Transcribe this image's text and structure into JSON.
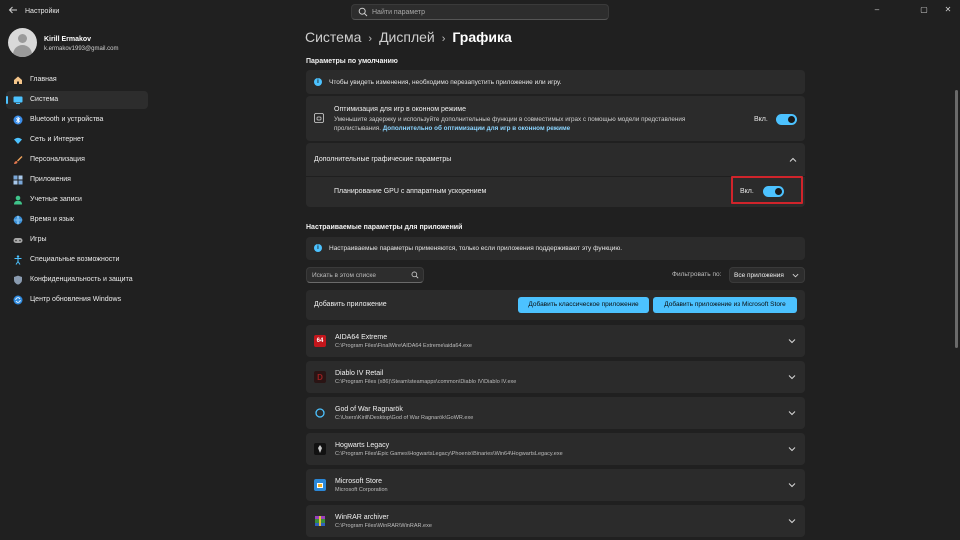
{
  "window": {
    "app_title": "Настройки",
    "search_placeholder": "Найти параметр",
    "controls": [
      "–",
      "▢",
      "✕"
    ]
  },
  "user": {
    "name": "Kirill Ermakov",
    "email": "k.ermakov1993@gmail.com"
  },
  "sidebar": {
    "items": [
      {
        "label": "Главная",
        "icon": "home-icon",
        "active": false
      },
      {
        "label": "Система",
        "icon": "system-icon",
        "active": true
      },
      {
        "label": "Bluetooth и устройства",
        "icon": "bluetooth-icon",
        "active": false
      },
      {
        "label": "Сеть и Интернет",
        "icon": "wifi-icon",
        "active": false
      },
      {
        "label": "Персонализация",
        "icon": "brush-icon",
        "active": false
      },
      {
        "label": "Приложения",
        "icon": "apps-icon",
        "active": false
      },
      {
        "label": "Учетные записи",
        "icon": "accounts-icon",
        "active": false
      },
      {
        "label": "Время и язык",
        "icon": "globe-icon",
        "active": false
      },
      {
        "label": "Игры",
        "icon": "gamepad-icon",
        "active": false
      },
      {
        "label": "Специальные возможности",
        "icon": "accessibility-icon",
        "active": false
      },
      {
        "label": "Конфиденциальность и защита",
        "icon": "shield-icon",
        "active": false
      },
      {
        "label": "Центр обновления Windows",
        "icon": "update-icon",
        "active": false
      }
    ]
  },
  "breadcrumb": {
    "part1": "Система",
    "part2": "Дисплей",
    "current": "Графика",
    "separator": "›"
  },
  "defaults_section": {
    "title": "Параметры по умолчанию",
    "info": "Чтобы увидеть изменения, необходимо перезапустить приложение или игру.",
    "windowed_opt": {
      "title": "Оптимизация для игр в оконном режиме",
      "desc": "Уменьшите задержку и используйте дополнительные функции в совместимых играх с помощью модели представления",
      "desc2": "пролистывания.",
      "link": "Дополнительно об оптимизации для игр в оконном режиме",
      "toggle_label": "Вкл.",
      "on": true
    },
    "advanced": {
      "title": "Дополнительные графические параметры",
      "gpu_sched": "Планирование GPU с аппаратным ускорением",
      "toggle_label": "Вкл.",
      "on": true
    }
  },
  "custom_section": {
    "title": "Настраиваемые параметры для приложений",
    "info": "Настраиваемые параметры применяются, только если приложения поддерживают эту функцию.",
    "search_placeholder": "Искать в этом списке",
    "filter_label": "Фильтровать по:",
    "filter_value": "Все приложения",
    "add_label": "Добавить приложение",
    "add_classic": "Добавить классическое приложение",
    "add_store": "Добавить приложение из Microsoft Store"
  },
  "apps": [
    {
      "name": "AIDA64 Extreme",
      "path": "C:\\Program Files\\FinalWire\\AIDA64 Extreme\\aida64.exe",
      "icon": "aida64-icon",
      "badge": "64"
    },
    {
      "name": "Diablo IV Retail",
      "path": "C:\\Program Files (x86)\\Steam\\steamapps\\common\\Diablo IV\\Diablo IV.exe",
      "icon": "diablo-icon",
      "badge": "D"
    },
    {
      "name": "God of War Ragnarök",
      "path": "C:\\Users\\Kirill\\Desktop\\God of War Ragnarök\\GoWR.exe",
      "icon": "gow-icon",
      "badge": ""
    },
    {
      "name": "Hogwarts Legacy",
      "path": "C:\\Program Files\\Epic Games\\HogwartsLegacy\\Phoenix\\Binaries\\Win64\\HogwartsLegacy.exe",
      "icon": "hogwarts-icon",
      "badge": ""
    },
    {
      "name": "Microsoft Store",
      "path": "Microsoft Corporation",
      "icon": "store-icon",
      "badge": ""
    },
    {
      "name": "WinRAR archiver",
      "path": "C:\\Program Files\\WinRAR\\WinRAR.exe",
      "icon": "winrar-icon",
      "badge": ""
    }
  ],
  "colors": {
    "accent": "#4cc2ff",
    "highlight": "#d0242b",
    "background": "#202020",
    "card": "#2b2b2b"
  }
}
